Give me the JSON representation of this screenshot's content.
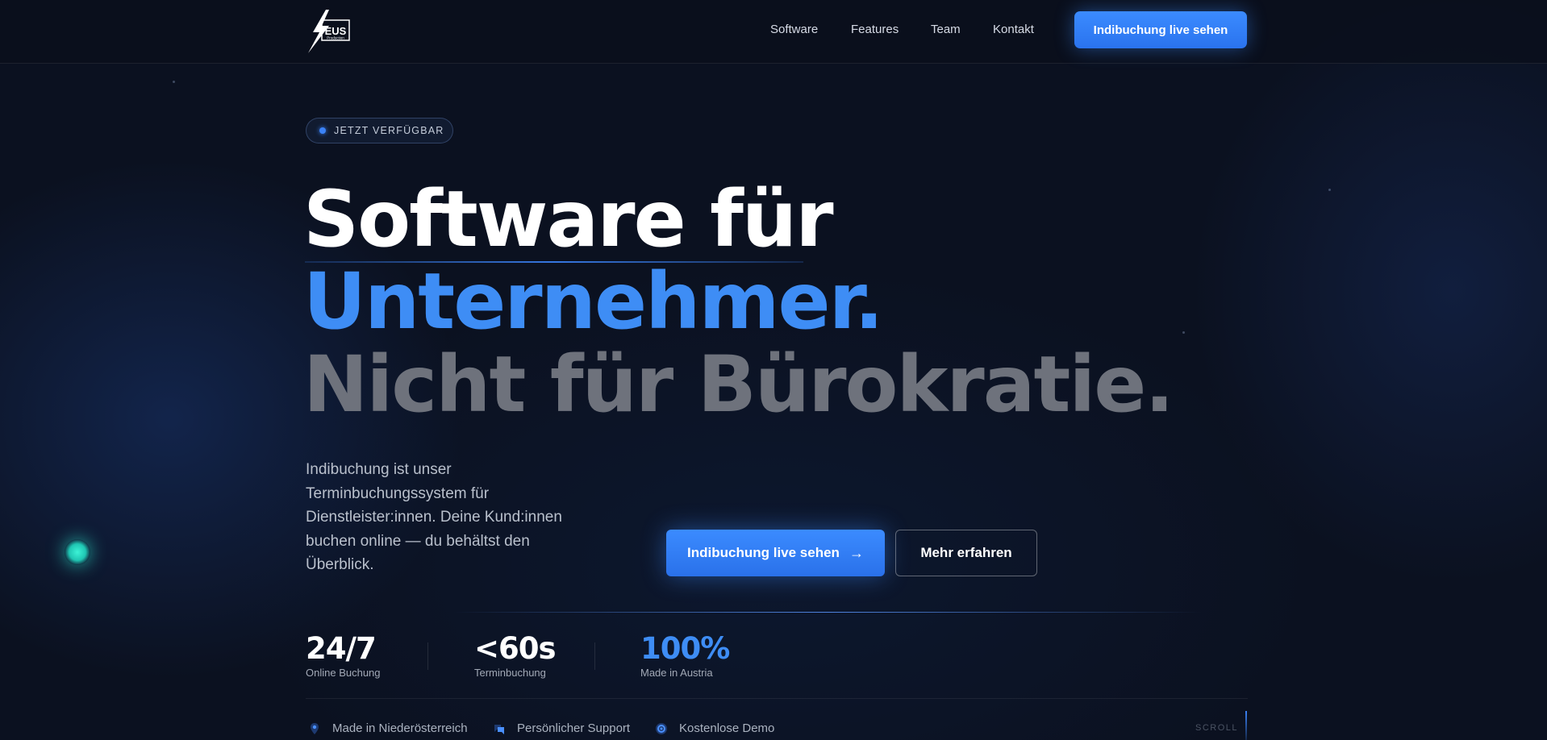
{
  "header": {
    "logo_text": "EUS",
    "logo_subtext": "Production",
    "nav": [
      "Software",
      "Features",
      "Team",
      "Kontakt"
    ],
    "cta_label": "Indibuchung live sehen"
  },
  "hero": {
    "badge": "JETZT VERFÜGBAR",
    "headline_line1": "Software für",
    "headline_line2": "Unternehmer.",
    "headline_line3": "Nicht für Bürokratie.",
    "description": "Indibuchung ist unser Terminbuchungssystem für Dienstleister:innen. Deine Kund:innen buchen online — du behältst den Überblick.",
    "primary_button": "Indibuchung live sehen",
    "primary_button_arrow": "→",
    "secondary_button": "Mehr erfahren"
  },
  "stats": [
    {
      "value": "24/7",
      "label": "Online Buchung"
    },
    {
      "value": "<60s",
      "label": "Terminbuchung"
    },
    {
      "value": "100%",
      "label": "Made in Austria"
    }
  ],
  "features": [
    {
      "icon": "location-pin-icon",
      "label": "Made in Niederösterreich"
    },
    {
      "icon": "chat-bubbles-icon",
      "label": "Persönlicher Support"
    },
    {
      "icon": "target-icon",
      "label": "Kostenlose Demo"
    }
  ],
  "scroll_label": "SCROLL",
  "colors": {
    "background": "#0b1120",
    "accent": "#3e8df5",
    "headline_muted": "#6e727c",
    "glow": "#3df2d6"
  }
}
